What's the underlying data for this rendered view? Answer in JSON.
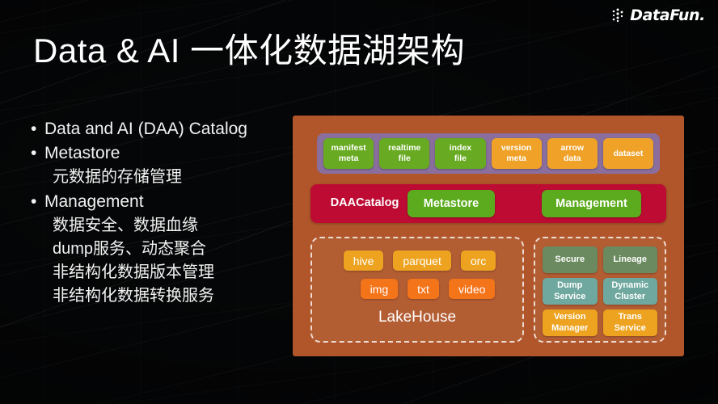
{
  "logo": {
    "name": "DataFun logo",
    "text": "DataFun.",
    "mark": "scatter-dots-d-mark"
  },
  "slide": {
    "title": "Data & AI 一体化数据湖架构",
    "bullets": [
      {
        "marker": "•",
        "text": "Data and AI (DAA) Catalog",
        "level": 1
      },
      {
        "marker": "•",
        "text": "Metastore",
        "level": 1
      },
      {
        "marker": "",
        "text": "元数据的存储管理",
        "level": 2
      },
      {
        "marker": "•",
        "text": "Management",
        "level": 1
      },
      {
        "marker": "",
        "text": "数据安全、数据血缘",
        "level": 2
      },
      {
        "marker": "",
        "text": "dump服务、动态聚合",
        "level": 2
      },
      {
        "marker": "",
        "text": "非结构化数据版本管理",
        "level": 2
      },
      {
        "marker": "",
        "text": "非结构化数据转换服务",
        "level": 2
      }
    ]
  },
  "diagram": {
    "panel_color": "#b0562a",
    "metadata_strip": {
      "strip_color": "#8a6e9e",
      "chips": [
        {
          "label": "manifest\nmeta",
          "color": "green"
        },
        {
          "label": "realtime\nfile",
          "color": "green"
        },
        {
          "label": "index\nfile",
          "color": "green"
        },
        {
          "label": "version\nmeta",
          "color": "orange"
        },
        {
          "label": "arrow\ndata",
          "color": "orange"
        },
        {
          "label": "dataset",
          "color": "orange"
        }
      ]
    },
    "catalog_band": {
      "band_color": "#bd0b33",
      "title": "DAA\nCatalog",
      "buttons": [
        {
          "label": "Metastore",
          "color": "#5cab1e"
        },
        {
          "label": "Management",
          "color": "#5cab1e"
        }
      ]
    },
    "lakehouse": {
      "title": "LakeHouse",
      "formats": [
        {
          "label": "hive",
          "color": "amber"
        },
        {
          "label": "parquet",
          "color": "amber"
        },
        {
          "label": "orc",
          "color": "amber"
        }
      ],
      "unstructured": [
        {
          "label": "img",
          "color": "orange"
        },
        {
          "label": "txt",
          "color": "orange"
        },
        {
          "label": "video",
          "color": "orange"
        }
      ]
    },
    "services": [
      {
        "label": "Secure",
        "color": "sage"
      },
      {
        "label": "Lineage",
        "color": "sage"
      },
      {
        "label": "Dump\nService",
        "color": "teal"
      },
      {
        "label": "Dynamic\nCluster",
        "color": "teal"
      },
      {
        "label": "Version\nManager",
        "color": "amber"
      },
      {
        "label": "Trans\nService",
        "color": "amber"
      }
    ]
  }
}
